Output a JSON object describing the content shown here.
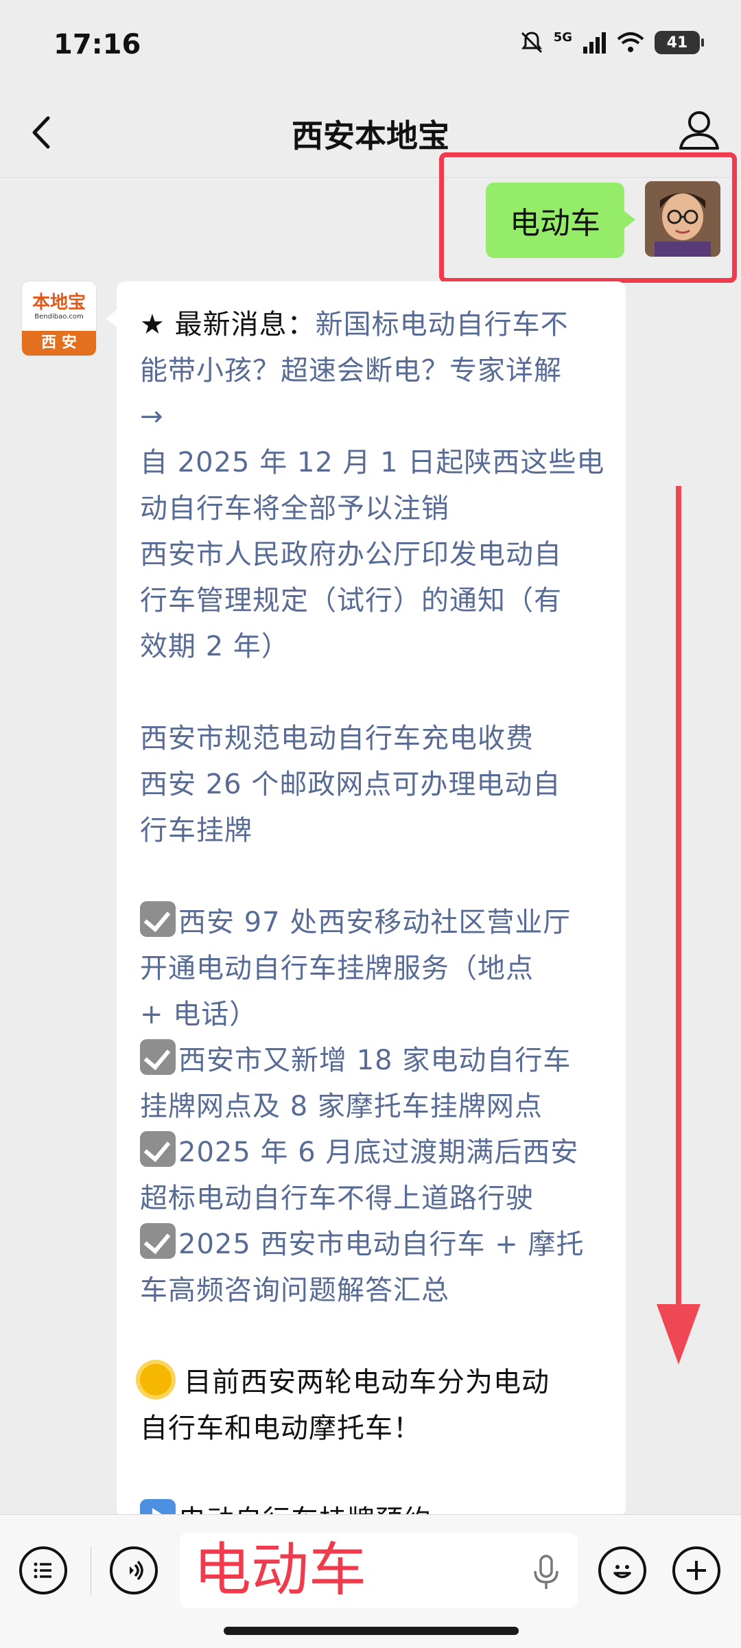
{
  "status_bar": {
    "time": "17:16",
    "network": "5G",
    "battery": "41"
  },
  "header": {
    "title": "西安本地宝"
  },
  "outgoing_message": {
    "text": "电动车"
  },
  "bot": {
    "logo_text": "本地宝",
    "logo_url": "Bendibao.com",
    "logo_city": "西 安"
  },
  "incoming_message": {
    "latest_prefix": "★ 最新消息：",
    "latest_link": [
      "新国标电动自行车不",
      "能带小孩？超速会断电？专家详解",
      "→"
    ],
    "link_block_1": [
      "自 2025 年 12 月 1 日起陕西这些电",
      "动自行车将全部予以注销",
      "西安市人民政府办公厅印发电动自",
      "行车管理规定（试行）的通知（有",
      "效期 2 年）"
    ],
    "link_block_2": [
      "西安市规范电动自行车充电收费",
      "西安 26 个邮政网点可办理电动自",
      "行车挂牌"
    ],
    "checked_items": [
      [
        "西安 97 处西安移动社区营业厅",
        "开通电动自行车挂牌服务（地点",
        "+ 电话）"
      ],
      [
        "西安市又新增 18 家电动自行车",
        "挂牌网点及 8 家摩托车挂牌网点"
      ],
      [
        "2025 年 6 月底过渡期满后西安",
        "超标电动自行车不得上道路行驶"
      ],
      [
        "2025 西安市电动自行车 + 摩托",
        "车高频咨询问题解答汇总"
      ]
    ],
    "sun_text": [
      "目前西安两轮电动车分为电动",
      "自行车和电动摩托车！"
    ],
    "cut_line": "电动自行车挂牌预约"
  },
  "input_bar": {
    "typed_text": "电动车"
  },
  "colors": {
    "link": "#576b95",
    "highlight": "#ef3b4b",
    "outgoing_bubble": "#95ec69"
  }
}
